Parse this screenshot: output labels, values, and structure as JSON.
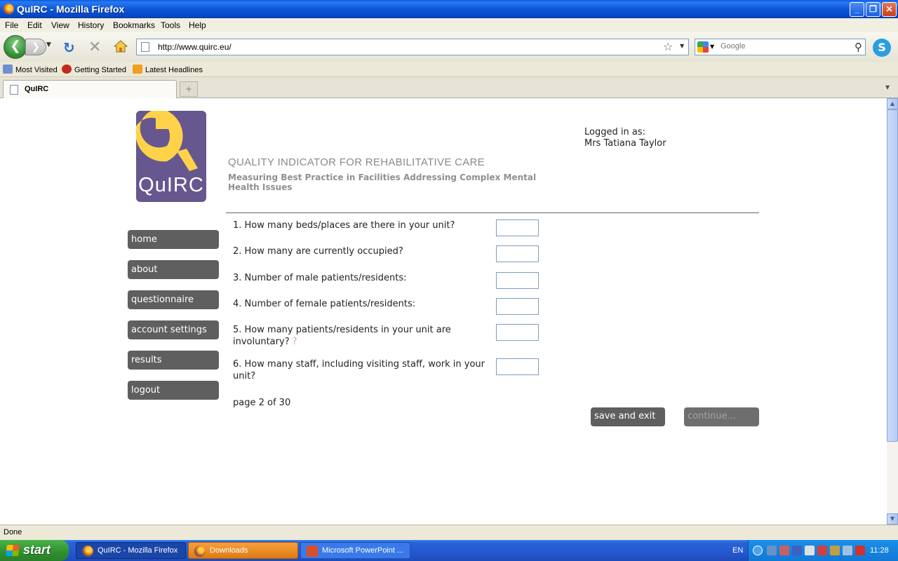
{
  "window": {
    "title": "QuIRC - Mozilla Firefox",
    "minimize": "_",
    "maximize": "❐",
    "close": "✕"
  },
  "menu": [
    "File",
    "Edit",
    "View",
    "History",
    "Bookmarks",
    "Tools",
    "Help"
  ],
  "toolbar": {
    "url": "http://www.quirc.eu/",
    "search_placeholder": "Google"
  },
  "bookmarks": [
    "Most Visited",
    "Getting Started",
    "Latest Headlines"
  ],
  "tabs": [
    {
      "label": "QuIRC"
    }
  ],
  "page": {
    "logo_text": "QuIRC",
    "title": "QUALITY INDICATOR FOR REHABILITATIVE CARE",
    "subtitle": "Measuring Best Practice in Facilities Addressing Complex Mental Health Issues",
    "login_label": "Logged in as:",
    "login_user": "Mrs Tatiana Taylor",
    "nav": [
      "home",
      "about",
      "questionnaire",
      "account settings",
      "results",
      "logout"
    ],
    "questions": [
      "1. How many beds/places are there in your unit?",
      "2. How many are currently occupied?",
      "3. Number of male patients/residents:",
      "4. Number of female patients/residents:",
      "5. How many patients/residents in your unit are involuntary?",
      "6. How many staff, including visiting staff, work in your unit?"
    ],
    "page_info": "page 2 of 30",
    "save_button": "save and exit",
    "continue_button": "continue..."
  },
  "status": "Done",
  "taskbar": {
    "start": "start",
    "items": [
      "QuIRC - Mozilla Firefox",
      "Downloads",
      "Microsoft PowerPoint ..."
    ],
    "lang": "EN",
    "clock": "11:28"
  },
  "colors": {
    "nav_button": "#5f5f5f",
    "logo_purple": "#67578f",
    "logo_yellow": "#ffd24a"
  }
}
